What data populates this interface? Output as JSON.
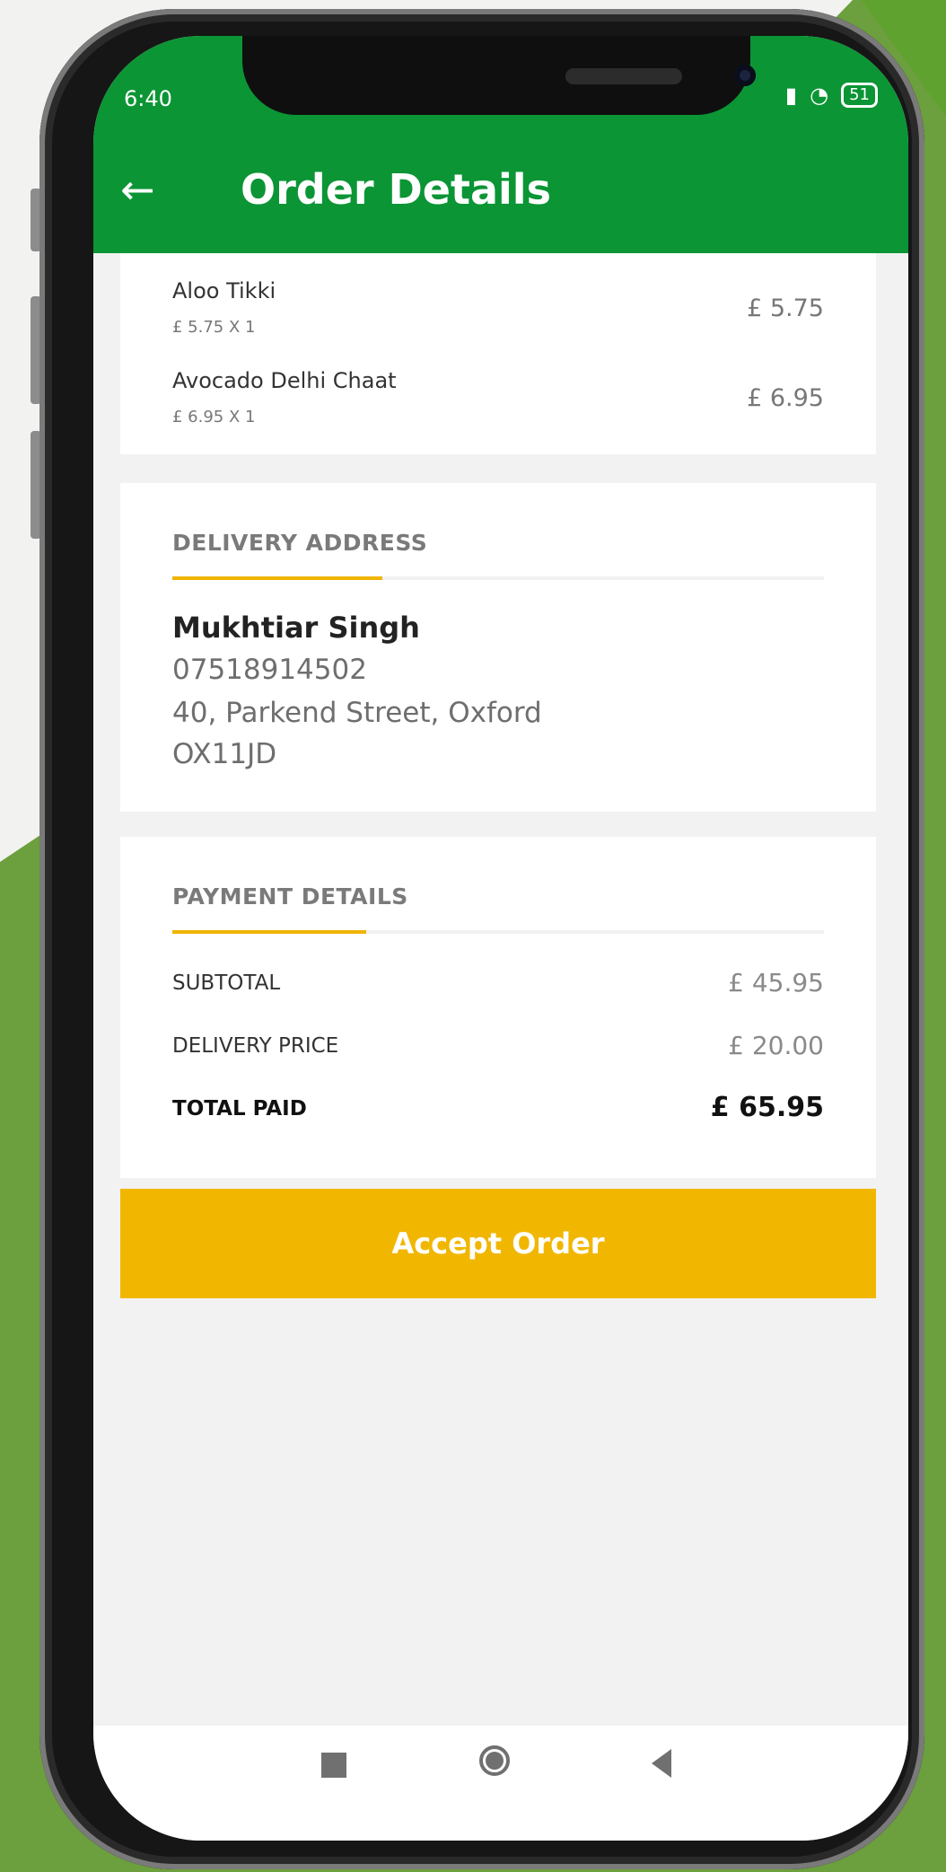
{
  "status_bar": {
    "time": "6:40",
    "battery": "51"
  },
  "header": {
    "title": "Order Details"
  },
  "order_items": [
    {
      "name": "Aloo Tikki",
      "qty": "£ 5.75 X 1",
      "price": "£ 5.75"
    },
    {
      "name": "Avocado Delhi Chaat",
      "qty": "£ 6.95 X 1",
      "price": "£ 6.95"
    }
  ],
  "delivery": {
    "title": "DELIVERY ADDRESS",
    "name": "Mukhtiar Singh",
    "phone": "07518914502",
    "street": "40, Parkend Street, Oxford",
    "postcode": "OX11JD"
  },
  "payment": {
    "title": "PAYMENT DETAILS",
    "subtotal_label": "SUBTOTAL",
    "subtotal_value": "£ 45.95",
    "delivery_label": "DELIVERY PRICE",
    "delivery_value": "£ 20.00",
    "total_label": "TOTAL PAID",
    "total_value": "£ 65.95"
  },
  "actions": {
    "accept_label": "Accept Order"
  },
  "colors": {
    "app_bar": "#0b9535",
    "accent": "#f1b700",
    "background_green": "#6c9f3d"
  },
  "icons": {
    "back": "arrow-left-icon",
    "nav_recents": "square-icon",
    "nav_home": "circle-icon",
    "nav_back": "triangle-left-icon"
  }
}
